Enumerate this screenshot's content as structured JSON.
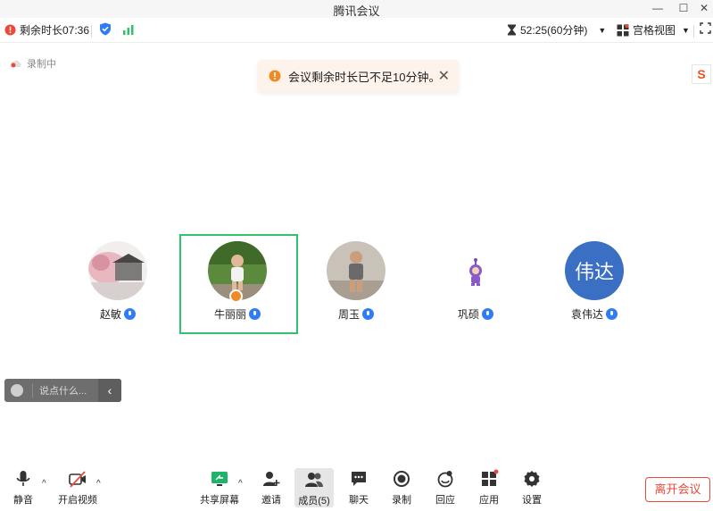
{
  "window": {
    "title": "腾讯会议"
  },
  "infobar": {
    "remaining": "剩余时长07:36",
    "timer": "52:25(60分钟)",
    "view_mode": "宫格视图"
  },
  "recording": {
    "label": "录制中"
  },
  "toast": {
    "message": "会议剩余时长已不足10分钟。"
  },
  "participants": [
    {
      "name": "赵敏",
      "avatar": "photo"
    },
    {
      "name": "牛丽丽",
      "avatar": "photo"
    },
    {
      "name": "周玉",
      "avatar": "photo"
    },
    {
      "name": "巩硕",
      "avatar": "cartoon"
    },
    {
      "name": "袁伟达",
      "avatar_text": "伟达",
      "avatar_color": "#3a6fc4"
    }
  ],
  "chat": {
    "placeholder": "说点什么..."
  },
  "toolbar": {
    "mute": "静音",
    "video": "开启视频",
    "share": "共享屏幕",
    "invite": "邀请",
    "members": "成员(5)",
    "chat": "聊天",
    "record": "录制",
    "react": "回应",
    "apps": "应用",
    "settings": "设置",
    "leave": "离开会议"
  },
  "colors": {
    "accent": "#2f7cf6",
    "selected_border": "#2fc36b",
    "leave": "#e94a3a",
    "warning": "#f08a24"
  }
}
